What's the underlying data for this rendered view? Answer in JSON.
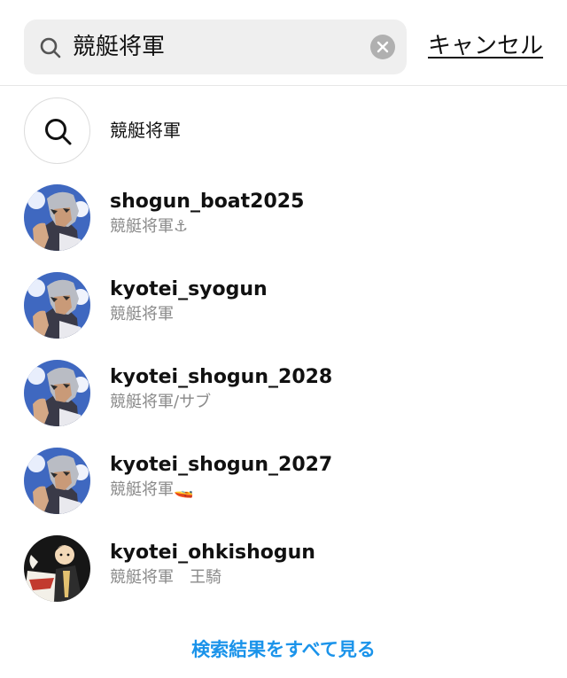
{
  "search": {
    "query": "競艇将軍",
    "cancel_label": "キャンセル"
  },
  "suggestion": {
    "query_text": "競艇将軍"
  },
  "results": [
    {
      "username": "shogun_boat2025",
      "fullname": "競艇将軍⚓"
    },
    {
      "username": "kyotei_syogun",
      "fullname": "競艇将軍"
    },
    {
      "username": "kyotei_shogun_2028",
      "fullname": "競艇将軍/サブ"
    },
    {
      "username": "kyotei_shogun_2027",
      "fullname": "競艇将軍🚤"
    },
    {
      "username": "kyotei_ohkishogun",
      "fullname": "競艇将軍　王騎"
    }
  ],
  "footer": {
    "see_all_label": "検索結果をすべて見る"
  },
  "colors": {
    "link": "#1a93ea",
    "search_bg": "#efefef",
    "secondary_text": "#8a8a8a"
  }
}
